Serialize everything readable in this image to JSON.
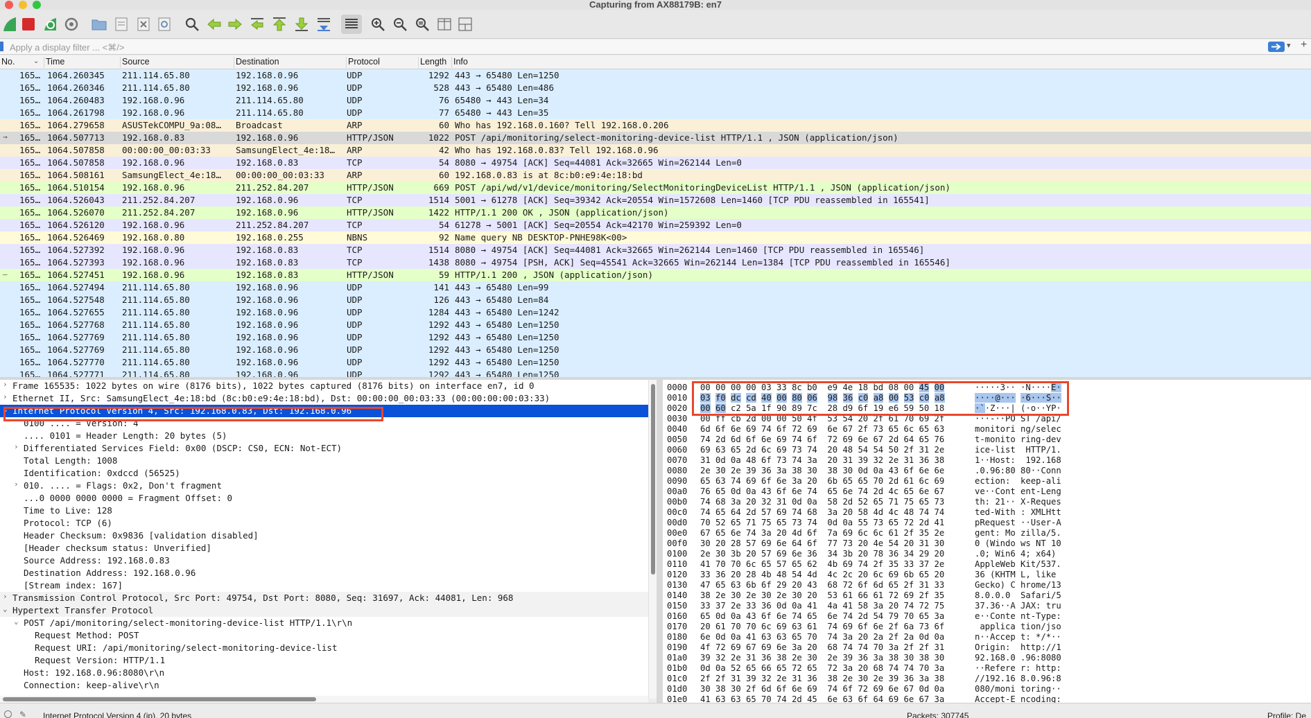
{
  "window": {
    "title": "Capturing from AX88179B: en7"
  },
  "toolbar": {
    "icons": [
      "start-capture-icon",
      "stop-capture-icon",
      "restart-capture-icon",
      "capture-options-icon",
      "open-file-icon",
      "save-file-icon",
      "close-file-icon",
      "reload-file-icon",
      "find-packet-icon",
      "go-back-icon",
      "go-forward-icon",
      "go-to-packet-icon",
      "go-first-icon",
      "go-last-icon",
      "autoscroll-icon",
      "colorize-icon",
      "zoom-in-icon",
      "zoom-out-icon",
      "zoom-normal-icon",
      "resize-columns-icon",
      "layout-icon"
    ]
  },
  "filter": {
    "placeholder": "Apply a display filter ... <⌘/>"
  },
  "packet_list": {
    "columns": [
      "No.",
      "Time",
      "Source",
      "Destination",
      "Protocol",
      "Length",
      "Info"
    ],
    "rows": [
      {
        "no": "165…",
        "time": "1064.260345",
        "src": "211.114.65.80",
        "dst": "192.168.0.96",
        "proto": "UDP",
        "len": "1292",
        "info": "443 → 65480 Len=1250",
        "color": "#daeeff",
        "marker": ""
      },
      {
        "no": "165…",
        "time": "1064.260346",
        "src": "211.114.65.80",
        "dst": "192.168.0.96",
        "proto": "UDP",
        "len": "528",
        "info": "443 → 65480 Len=486",
        "color": "#daeeff",
        "marker": ""
      },
      {
        "no": "165…",
        "time": "1064.260483",
        "src": "192.168.0.96",
        "dst": "211.114.65.80",
        "proto": "UDP",
        "len": "76",
        "info": "65480 → 443 Len=34",
        "color": "#daeeff",
        "marker": ""
      },
      {
        "no": "165…",
        "time": "1064.261798",
        "src": "192.168.0.96",
        "dst": "211.114.65.80",
        "proto": "UDP",
        "len": "77",
        "info": "65480 → 443 Len=35",
        "color": "#daeeff",
        "marker": ""
      },
      {
        "no": "165…",
        "time": "1064.279658",
        "src": "ASUSTekCOMPU_9a:08…",
        "dst": "Broadcast",
        "proto": "ARP",
        "len": "60",
        "info": "Who has 192.168.0.160? Tell 192.168.0.206",
        "color": "#faf0d7",
        "marker": ""
      },
      {
        "no": "165…",
        "time": "1064.507713",
        "src": "192.168.0.83",
        "dst": "192.168.0.96",
        "proto": "HTTP/JSON",
        "len": "1022",
        "info": "POST /api/monitoring/select-monitoring-device-list HTTP/1.1 , JSON (application/json)",
        "color": "#d9d9d9",
        "marker": "→"
      },
      {
        "no": "165…",
        "time": "1064.507858",
        "src": "00:00:00_00:03:33",
        "dst": "SamsungElect_4e:18…",
        "proto": "ARP",
        "len": "42",
        "info": "Who has 192.168.0.83? Tell 192.168.0.96",
        "color": "#faf0d7",
        "marker": ""
      },
      {
        "no": "165…",
        "time": "1064.507858",
        "src": "192.168.0.96",
        "dst": "192.168.0.83",
        "proto": "TCP",
        "len": "54",
        "info": "8080 → 49754 [ACK] Seq=44081 Ack=32665 Win=262144 Len=0",
        "color": "#e7e6ff",
        "marker": ""
      },
      {
        "no": "165…",
        "time": "1064.508161",
        "src": "SamsungElect_4e:18…",
        "dst": "00:00:00_00:03:33",
        "proto": "ARP",
        "len": "60",
        "info": "192.168.0.83 is at 8c:b0:e9:4e:18:bd",
        "color": "#faf0d7",
        "marker": ""
      },
      {
        "no": "165…",
        "time": "1064.510154",
        "src": "192.168.0.96",
        "dst": "211.252.84.207",
        "proto": "HTTP/JSON",
        "len": "669",
        "info": "POST /api/wd/v1/device/monitoring/SelectMonitoringDeviceList HTTP/1.1 , JSON (application/json)",
        "color": "#e4ffc7",
        "marker": ""
      },
      {
        "no": "165…",
        "time": "1064.526043",
        "src": "211.252.84.207",
        "dst": "192.168.0.96",
        "proto": "TCP",
        "len": "1514",
        "info": "5001 → 61278 [ACK] Seq=39342 Ack=20554 Win=1572608 Len=1460 [TCP PDU reassembled in 165541]",
        "color": "#e7e6ff",
        "marker": ""
      },
      {
        "no": "165…",
        "time": "1064.526070",
        "src": "211.252.84.207",
        "dst": "192.168.0.96",
        "proto": "HTTP/JSON",
        "len": "1422",
        "info": "HTTP/1.1 200 OK , JSON (application/json)",
        "color": "#e4ffc7",
        "marker": ""
      },
      {
        "no": "165…",
        "time": "1064.526120",
        "src": "192.168.0.96",
        "dst": "211.252.84.207",
        "proto": "TCP",
        "len": "54",
        "info": "61278 → 5001 [ACK] Seq=20554 Ack=42170 Win=259392 Len=0",
        "color": "#e7e6ff",
        "marker": ""
      },
      {
        "no": "165…",
        "time": "1064.526469",
        "src": "192.168.0.80",
        "dst": "192.168.0.255",
        "proto": "NBNS",
        "len": "92",
        "info": "Name query NB DESKTOP-PNHE98K<00>",
        "color": "#fffad7",
        "marker": ""
      },
      {
        "no": "165…",
        "time": "1064.527392",
        "src": "192.168.0.96",
        "dst": "192.168.0.83",
        "proto": "TCP",
        "len": "1514",
        "info": "8080 → 49754 [ACK] Seq=44081 Ack=32665 Win=262144 Len=1460 [TCP PDU reassembled in 165546]",
        "color": "#e7e6ff",
        "marker": ""
      },
      {
        "no": "165…",
        "time": "1064.527393",
        "src": "192.168.0.96",
        "dst": "192.168.0.83",
        "proto": "TCP",
        "len": "1438",
        "info": "8080 → 49754 [PSH, ACK] Seq=45541 Ack=32665 Win=262144 Len=1384 [TCP PDU reassembled in 165546]",
        "color": "#e7e6ff",
        "marker": ""
      },
      {
        "no": "165…",
        "time": "1064.527451",
        "src": "192.168.0.96",
        "dst": "192.168.0.83",
        "proto": "HTTP/JSON",
        "len": "59",
        "info": "HTTP/1.1 200  , JSON (application/json)",
        "color": "#e4ffc7",
        "marker": "—"
      },
      {
        "no": "165…",
        "time": "1064.527494",
        "src": "211.114.65.80",
        "dst": "192.168.0.96",
        "proto": "UDP",
        "len": "141",
        "info": "443 → 65480 Len=99",
        "color": "#daeeff",
        "marker": ""
      },
      {
        "no": "165…",
        "time": "1064.527548",
        "src": "211.114.65.80",
        "dst": "192.168.0.96",
        "proto": "UDP",
        "len": "126",
        "info": "443 → 65480 Len=84",
        "color": "#daeeff",
        "marker": ""
      },
      {
        "no": "165…",
        "time": "1064.527655",
        "src": "211.114.65.80",
        "dst": "192.168.0.96",
        "proto": "UDP",
        "len": "1284",
        "info": "443 → 65480 Len=1242",
        "color": "#daeeff",
        "marker": ""
      },
      {
        "no": "165…",
        "time": "1064.527768",
        "src": "211.114.65.80",
        "dst": "192.168.0.96",
        "proto": "UDP",
        "len": "1292",
        "info": "443 → 65480 Len=1250",
        "color": "#daeeff",
        "marker": ""
      },
      {
        "no": "165…",
        "time": "1064.527769",
        "src": "211.114.65.80",
        "dst": "192.168.0.96",
        "proto": "UDP",
        "len": "1292",
        "info": "443 → 65480 Len=1250",
        "color": "#daeeff",
        "marker": ""
      },
      {
        "no": "165…",
        "time": "1064.527769",
        "src": "211.114.65.80",
        "dst": "192.168.0.96",
        "proto": "UDP",
        "len": "1292",
        "info": "443 → 65480 Len=1250",
        "color": "#daeeff",
        "marker": ""
      },
      {
        "no": "165…",
        "time": "1064.527770",
        "src": "211.114.65.80",
        "dst": "192.168.0.96",
        "proto": "UDP",
        "len": "1292",
        "info": "443 → 65480 Len=1250",
        "color": "#daeeff",
        "marker": ""
      },
      {
        "no": "165…",
        "time": "1064.527771",
        "src": "211.114.65.80",
        "dst": "192.168.0.96",
        "proto": "UDP",
        "len": "1292",
        "info": "443 → 65480 Len=1250",
        "color": "#daeeff",
        "marker": ""
      }
    ]
  },
  "details": {
    "rows": [
      {
        "indent": 0,
        "twisty": "›",
        "text": "Frame 165535: 1022 bytes on wire (8176 bits), 1022 bytes captured (8176 bits) on interface en7, id 0",
        "kind": "normal"
      },
      {
        "indent": 0,
        "twisty": "›",
        "text": "Ethernet II, Src: SamsungElect_4e:18:bd (8c:b0:e9:4e:18:bd), Dst: 00:00:00_00:03:33 (00:00:00:00:03:33)",
        "kind": "normal"
      },
      {
        "indent": 0,
        "twisty": "⌄",
        "text": "Internet Protocol Version 4, Src: 192.168.0.83, Dst: 192.168.0.96",
        "kind": "selected"
      },
      {
        "indent": 1,
        "twisty": "",
        "text": "0100 .... = Version: 4",
        "kind": "normal"
      },
      {
        "indent": 1,
        "twisty": "",
        "text": ".... 0101 = Header Length: 20 bytes (5)",
        "kind": "normal"
      },
      {
        "indent": 1,
        "twisty": "›",
        "text": "Differentiated Services Field: 0x00 (DSCP: CS0, ECN: Not-ECT)",
        "kind": "normal"
      },
      {
        "indent": 1,
        "twisty": "",
        "text": "Total Length: 1008",
        "kind": "normal"
      },
      {
        "indent": 1,
        "twisty": "",
        "text": "Identification: 0xdccd (56525)",
        "kind": "normal"
      },
      {
        "indent": 1,
        "twisty": "›",
        "text": "010. .... = Flags: 0x2, Don't fragment",
        "kind": "normal"
      },
      {
        "indent": 1,
        "twisty": "",
        "text": "...0 0000 0000 0000 = Fragment Offset: 0",
        "kind": "normal"
      },
      {
        "indent": 1,
        "twisty": "",
        "text": "Time to Live: 128",
        "kind": "normal"
      },
      {
        "indent": 1,
        "twisty": "",
        "text": "Protocol: TCP (6)",
        "kind": "normal"
      },
      {
        "indent": 1,
        "twisty": "",
        "text": "Header Checksum: 0x9836 [validation disabled]",
        "kind": "normal"
      },
      {
        "indent": 1,
        "twisty": "",
        "text": "[Header checksum status: Unverified]",
        "kind": "normal"
      },
      {
        "indent": 1,
        "twisty": "",
        "text": "Source Address: 192.168.0.83",
        "kind": "normal"
      },
      {
        "indent": 1,
        "twisty": "",
        "text": "Destination Address: 192.168.0.96",
        "kind": "normal"
      },
      {
        "indent": 1,
        "twisty": "",
        "text": "[Stream index: 167]",
        "kind": "normal"
      },
      {
        "indent": 0,
        "twisty": "›",
        "text": "Transmission Control Protocol, Src Port: 49754, Dst Port: 8080, Seq: 31697, Ack: 44081, Len: 968",
        "kind": "section"
      },
      {
        "indent": 0,
        "twisty": "⌄",
        "text": "Hypertext Transfer Protocol",
        "kind": "section"
      },
      {
        "indent": 1,
        "twisty": "⌄",
        "text": "POST /api/monitoring/select-monitoring-device-list HTTP/1.1\\r\\n",
        "kind": "normal"
      },
      {
        "indent": 2,
        "twisty": "",
        "text": "Request Method: POST",
        "kind": "normal"
      },
      {
        "indent": 2,
        "twisty": "",
        "text": "Request URI: /api/monitoring/select-monitoring-device-list",
        "kind": "normal"
      },
      {
        "indent": 2,
        "twisty": "",
        "text": "Request Version: HTTP/1.1",
        "kind": "normal"
      },
      {
        "indent": 1,
        "twisty": "",
        "text": "Host: 192.168.0.96:8080\\r\\n",
        "kind": "normal"
      },
      {
        "indent": 1,
        "twisty": "",
        "text": "Connection: keep-alive\\r\\n",
        "kind": "normal"
      }
    ]
  },
  "bytes": {
    "rows": [
      {
        "off": "0000",
        "hex": "00 00 00 00 03 33 8c b0  e9 4e 18 bd 08 00 45 00",
        "ascii": "·····3·· ·N····E·"
      },
      {
        "off": "0010",
        "hex": "03 f0 dc cd 40 00 80 06  98 36 c0 a8 00 53 c0 a8",
        "ascii": "····@··· ·6···S··"
      },
      {
        "off": "0020",
        "hex": "00 60 c2 5a 1f 90 89 7c  28 d9 6f 19 e6 59 50 18",
        "ascii": "·`·Z···| (·o··YP·"
      },
      {
        "off": "0030",
        "hex": "00 ff cb 2d 00 00 50 4f  53 54 20 2f 61 70 69 2f",
        "ascii": "···-··PO ST /api/"
      },
      {
        "off": "0040",
        "hex": "6d 6f 6e 69 74 6f 72 69  6e 67 2f 73 65 6c 65 63",
        "ascii": "monitori ng/selec"
      },
      {
        "off": "0050",
        "hex": "74 2d 6d 6f 6e 69 74 6f  72 69 6e 67 2d 64 65 76",
        "ascii": "t-monito ring-dev"
      },
      {
        "off": "0060",
        "hex": "69 63 65 2d 6c 69 73 74  20 48 54 54 50 2f 31 2e",
        "ascii": "ice-list  HTTP/1."
      },
      {
        "off": "0070",
        "hex": "31 0d 0a 48 6f 73 74 3a  20 31 39 32 2e 31 36 38",
        "ascii": "1··Host:  192.168"
      },
      {
        "off": "0080",
        "hex": "2e 30 2e 39 36 3a 38 30  38 30 0d 0a 43 6f 6e 6e",
        "ascii": ".0.96:80 80··Conn"
      },
      {
        "off": "0090",
        "hex": "65 63 74 69 6f 6e 3a 20  6b 65 65 70 2d 61 6c 69",
        "ascii": "ection:  keep-ali"
      },
      {
        "off": "00a0",
        "hex": "76 65 0d 0a 43 6f 6e 74  65 6e 74 2d 4c 65 6e 67",
        "ascii": "ve··Cont ent-Leng"
      },
      {
        "off": "00b0",
        "hex": "74 68 3a 20 32 31 0d 0a  58 2d 52 65 71 75 65 73",
        "ascii": "th: 21·· X-Reques"
      },
      {
        "off": "00c0",
        "hex": "74 65 64 2d 57 69 74 68  3a 20 58 4d 4c 48 74 74",
        "ascii": "ted-With : XMLHtt"
      },
      {
        "off": "00d0",
        "hex": "70 52 65 71 75 65 73 74  0d 0a 55 73 65 72 2d 41",
        "ascii": "pRequest ··User-A"
      },
      {
        "off": "00e0",
        "hex": "67 65 6e 74 3a 20 4d 6f  7a 69 6c 6c 61 2f 35 2e",
        "ascii": "gent: Mo zilla/5."
      },
      {
        "off": "00f0",
        "hex": "30 20 28 57 69 6e 64 6f  77 73 20 4e 54 20 31 30",
        "ascii": "0 (Windo ws NT 10"
      },
      {
        "off": "0100",
        "hex": "2e 30 3b 20 57 69 6e 36  34 3b 20 78 36 34 29 20",
        "ascii": ".0; Win6 4; x64) "
      },
      {
        "off": "0110",
        "hex": "41 70 70 6c 65 57 65 62  4b 69 74 2f 35 33 37 2e",
        "ascii": "AppleWeb Kit/537."
      },
      {
        "off": "0120",
        "hex": "33 36 20 28 4b 48 54 4d  4c 2c 20 6c 69 6b 65 20",
        "ascii": "36 (KHTM L, like "
      },
      {
        "off": "0130",
        "hex": "47 65 63 6b 6f 29 20 43  68 72 6f 6d 65 2f 31 33",
        "ascii": "Gecko) C hrome/13"
      },
      {
        "off": "0140",
        "hex": "38 2e 30 2e 30 2e 30 20  53 61 66 61 72 69 2f 35",
        "ascii": "8.0.0.0  Safari/5"
      },
      {
        "off": "0150",
        "hex": "33 37 2e 33 36 0d 0a 41  4a 41 58 3a 20 74 72 75",
        "ascii": "37.36··A JAX: tru"
      },
      {
        "off": "0160",
        "hex": "65 0d 0a 43 6f 6e 74 65  6e 74 2d 54 79 70 65 3a",
        "ascii": "e··Conte nt-Type:"
      },
      {
        "off": "0170",
        "hex": "20 61 70 70 6c 69 63 61  74 69 6f 6e 2f 6a 73 6f",
        "ascii": " applica tion/jso"
      },
      {
        "off": "0180",
        "hex": "6e 0d 0a 41 63 63 65 70  74 3a 20 2a 2f 2a 0d 0a",
        "ascii": "n··Accep t: */*··"
      },
      {
        "off": "0190",
        "hex": "4f 72 69 67 69 6e 3a 20  68 74 74 70 3a 2f 2f 31",
        "ascii": "Origin:  http://1"
      },
      {
        "off": "01a0",
        "hex": "39 32 2e 31 36 38 2e 30  2e 39 36 3a 38 30 38 30",
        "ascii": "92.168.0 .96:8080"
      },
      {
        "off": "01b0",
        "hex": "0d 0a 52 65 66 65 72 65  72 3a 20 68 74 74 70 3a",
        "ascii": "··Refere r: http:"
      },
      {
        "off": "01c0",
        "hex": "2f 2f 31 39 32 2e 31 36  38 2e 30 2e 39 36 3a 38",
        "ascii": "//192.16 8.0.96:8"
      },
      {
        "off": "01d0",
        "hex": "30 38 30 2f 6d 6f 6e 69  74 6f 72 69 6e 67 0d 0a",
        "ascii": "080/moni toring··"
      },
      {
        "off": "01e0",
        "hex": "41 63 63 65 70 74 2d 45  6e 63 6f 64 69 6e 67 3a",
        "ascii": "Accept-E ncoding:"
      }
    ]
  },
  "status": {
    "left": "Internet Protocol Version 4 (ip), 20 bytes",
    "packets": "Packets: 307745",
    "profile": "Profile: De"
  }
}
